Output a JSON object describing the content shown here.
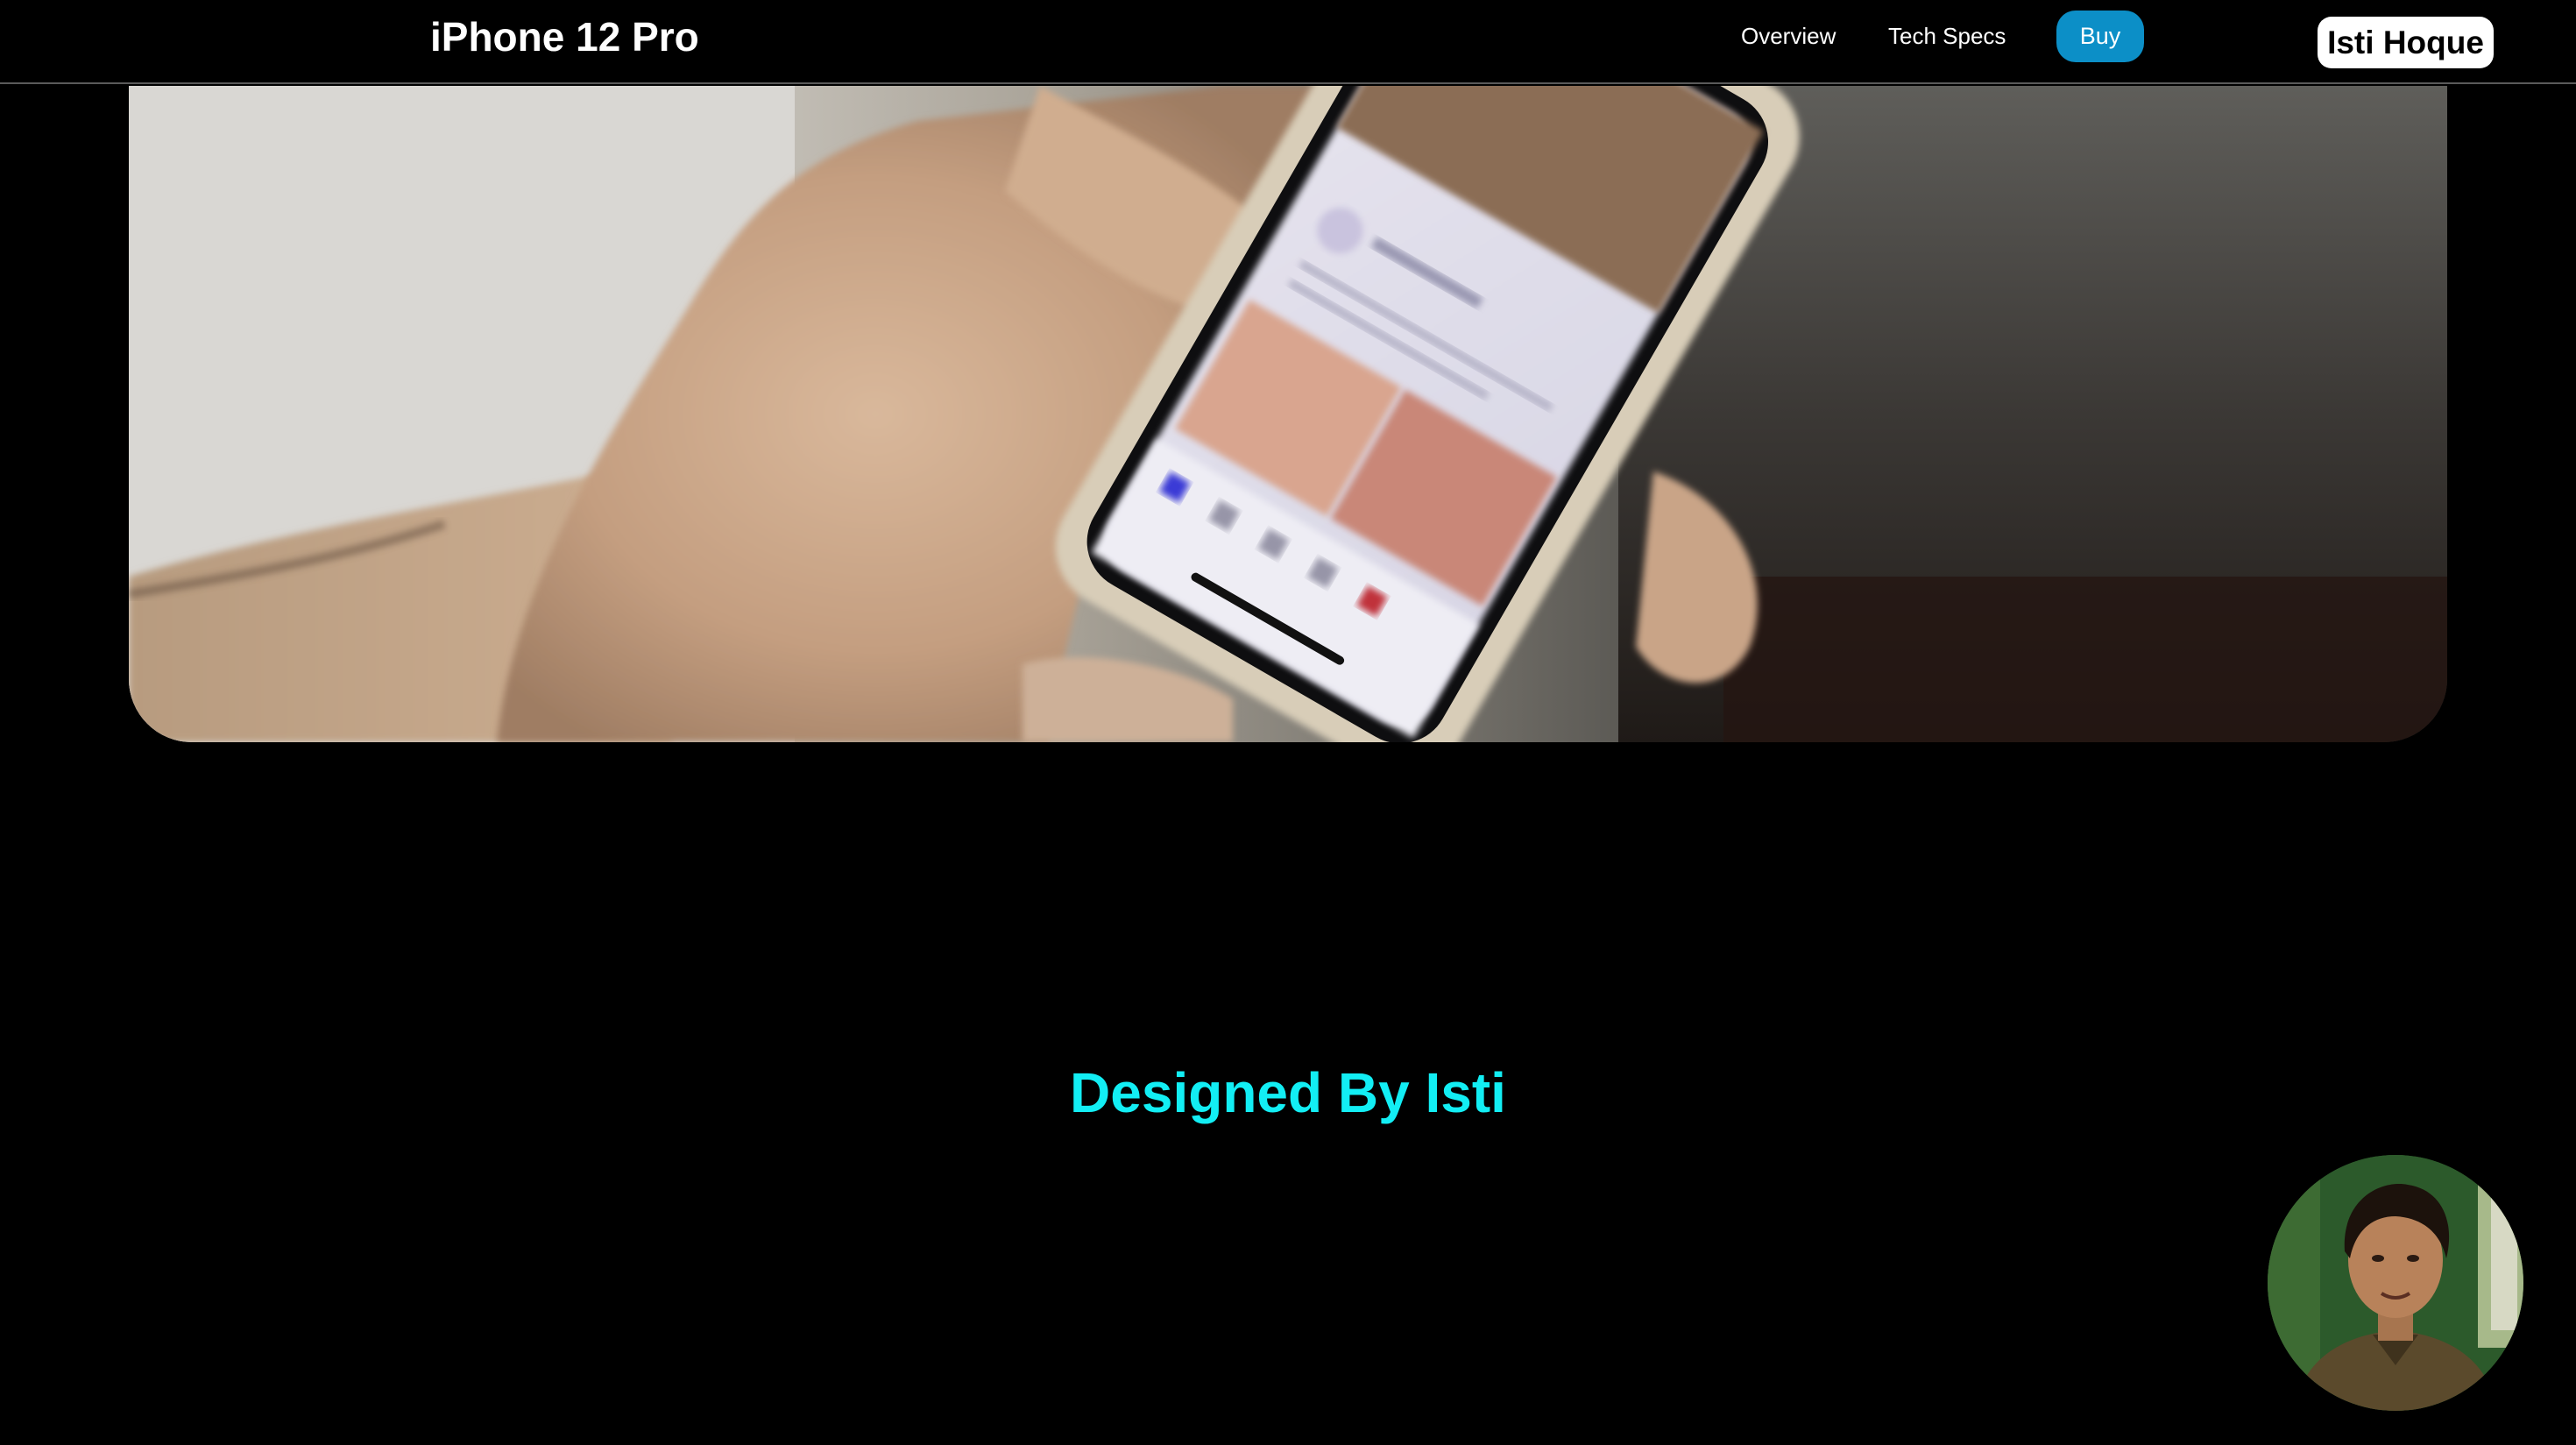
{
  "nav": {
    "brand": "iPhone 12 Pro",
    "links": [
      {
        "label": "Overview"
      },
      {
        "label": "Tech Specs"
      }
    ],
    "buy_label": "Buy",
    "user_name": "Isti Hoque"
  },
  "hero": {
    "media": "hand-holding-phone-video"
  },
  "footer": {
    "credit": "Designed By Isti"
  },
  "avatar": {
    "icon": "profile-photo"
  },
  "colors": {
    "accent_button": "#0c8fc7",
    "credit_text": "#12eef4",
    "background": "#000000",
    "nav_border": "#5a5a5a"
  }
}
